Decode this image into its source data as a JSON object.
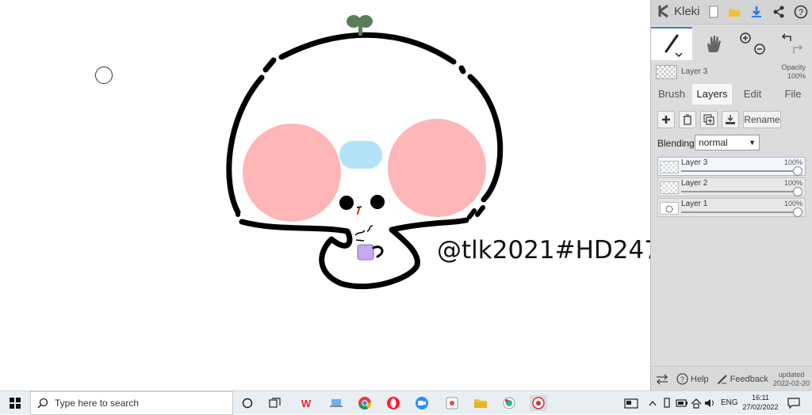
{
  "canvas": {
    "watermark": "@tlk2021#HD247"
  },
  "app": {
    "name": "Kleki",
    "current_layer": "Layer 3",
    "opacity_label": "Opacity",
    "opacity_value": "100%"
  },
  "tabs": [
    {
      "label": "Brush"
    },
    {
      "label": "Layers"
    },
    {
      "label": "Edit"
    },
    {
      "label": "File"
    }
  ],
  "layers_panel": {
    "rename_label": "Rename",
    "blending_label": "Blending",
    "blending_value": "normal",
    "layers": [
      {
        "name": "Layer 3",
        "opacity": "100%"
      },
      {
        "name": "Layer 2",
        "opacity": "100%"
      },
      {
        "name": "Layer 1",
        "opacity": "100%"
      }
    ]
  },
  "footer": {
    "help": "Help",
    "feedback": "Feedback",
    "updated_label": "updated",
    "updated_date": "2022-02-20"
  },
  "taskbar": {
    "search_placeholder": "Type here to search",
    "lang": "ENG",
    "time": "16:11",
    "date": "27/02/2022"
  },
  "colors": {
    "accent": "#3a7be0",
    "cheek": "#ffb6b6",
    "forehead": "#b3e3f7",
    "cup": "#c9a8f0",
    "sprout": "#5a7e56"
  }
}
